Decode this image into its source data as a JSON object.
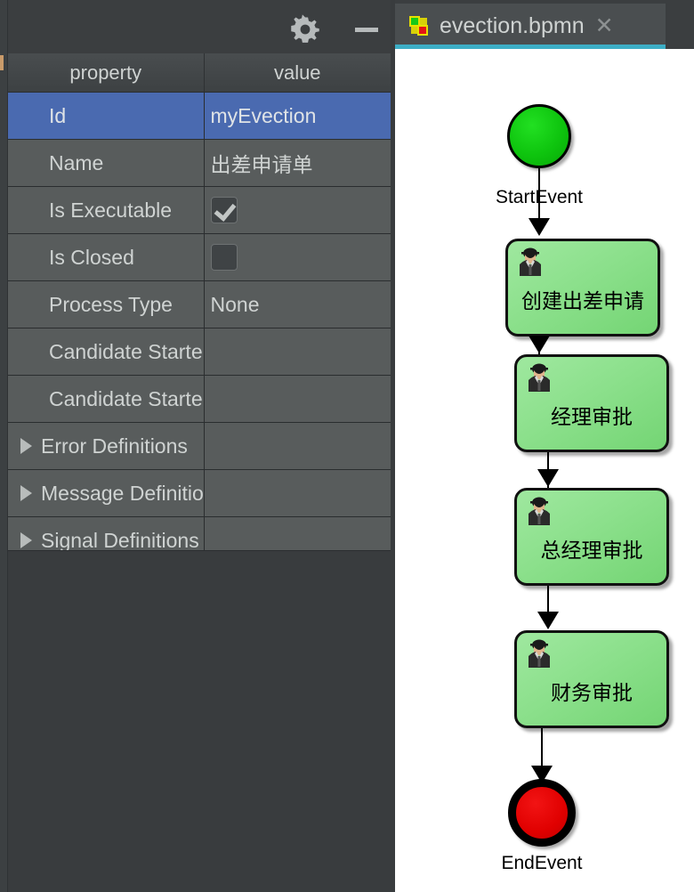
{
  "panel": {
    "toolbar": {
      "gear_icon": "gear-icon",
      "minimize_icon": "minimize-icon"
    },
    "table": {
      "headers": [
        "property",
        "value"
      ],
      "rows": [
        {
          "property": "Id",
          "value": "myEvection",
          "type": "text",
          "expandable": false,
          "selected": true
        },
        {
          "property": "Name",
          "value": "出差申请单",
          "type": "text",
          "expandable": false,
          "selected": false
        },
        {
          "property": "Is Executable",
          "value": "",
          "type": "checkbox",
          "checked": true,
          "expandable": false,
          "selected": false
        },
        {
          "property": "Is Closed",
          "value": "",
          "type": "checkbox",
          "checked": false,
          "expandable": false,
          "selected": false
        },
        {
          "property": "Process Type",
          "value": "None",
          "type": "text",
          "expandable": false,
          "selected": false
        },
        {
          "property": "Candidate Starter Groups",
          "value": "",
          "type": "text",
          "expandable": false,
          "selected": false
        },
        {
          "property": "Candidate Starter Users",
          "value": "",
          "type": "text",
          "expandable": false,
          "selected": false
        },
        {
          "property": "Error Definitions",
          "value": "",
          "type": "text",
          "expandable": true,
          "selected": false
        },
        {
          "property": "Message Definitions",
          "value": "",
          "type": "text",
          "expandable": true,
          "selected": false
        },
        {
          "property": "Signal Definitions",
          "value": "",
          "type": "text",
          "expandable": true,
          "selected": false
        }
      ]
    }
  },
  "editor": {
    "tab": {
      "title": "evection.bpmn",
      "icon": "bpmn-diagram-icon",
      "close_label": "✕",
      "active_underline_color": "#3daec6"
    },
    "diagram": {
      "nodes": [
        {
          "kind": "start-event",
          "label": "StartEvent",
          "icon": "start-event-icon"
        },
        {
          "kind": "user-task",
          "label": "创建出差申请",
          "icon": "user-task-icon"
        },
        {
          "kind": "user-task",
          "label": "经理审批",
          "icon": "user-task-icon"
        },
        {
          "kind": "user-task",
          "label": "总经理审批",
          "icon": "user-task-icon"
        },
        {
          "kind": "user-task",
          "label": "财务审批",
          "icon": "user-task-icon"
        },
        {
          "kind": "end-event",
          "label": "EndEvent",
          "icon": "end-event-icon"
        }
      ]
    }
  },
  "colors": {
    "selection_blue": "#4a6ab0",
    "panel_bg": "#393c3e",
    "row_bg": "#585c5c",
    "task_green": "#8ce08c",
    "start_green": "#0ec40e",
    "end_red": "#e00000",
    "tab_accent": "#3daec6"
  }
}
